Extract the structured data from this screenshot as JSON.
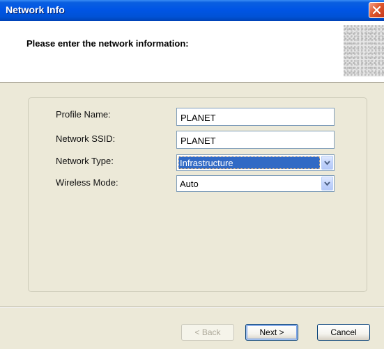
{
  "window": {
    "title": "Network Info",
    "heading": "Please enter the network information:"
  },
  "form": {
    "profile_name": {
      "label": "Profile Name:",
      "value": "PLANET"
    },
    "network_ssid": {
      "label": "Network SSID:",
      "value": "PLANET"
    },
    "network_type": {
      "label": "Network Type:",
      "value": "Infrastructure"
    },
    "wireless_mode": {
      "label": "Wireless Mode:",
      "value": "Auto"
    }
  },
  "buttons": {
    "back": "< Back",
    "next": "Next >",
    "cancel": "Cancel"
  },
  "colors": {
    "titlebar": "#0055e5",
    "dialog_bg": "#ece9d8",
    "selection": "#316ac5",
    "close_button": "#e0592e"
  },
  "icons": {
    "close": "close-icon",
    "dropdown": "chevron-down-icon",
    "logo": "header-logo"
  }
}
